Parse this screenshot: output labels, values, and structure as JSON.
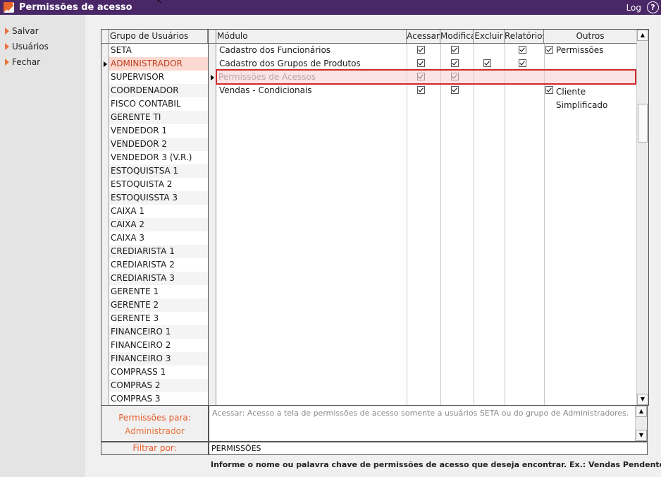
{
  "window": {
    "title": "Permissões de acesso",
    "log_label": "Log",
    "help_symbol": "?"
  },
  "sidebar": {
    "items": [
      {
        "label": "Salvar"
      },
      {
        "label": "Usuários"
      },
      {
        "label": "Fechar"
      }
    ]
  },
  "groups": {
    "header": "Grupo de Usuários",
    "selected_index": 1,
    "items": [
      "SETA",
      "ADMINISTRADOR",
      "SUPERVISOR",
      "COORDENADOR",
      "FISCO CONTABIL",
      "GERENTE TI",
      "VENDEDOR 1",
      "VENDEDOR 2",
      "VENDEDOR 3 (V.R.)",
      "ESTOQUISTSA 1",
      "ESTOQUISTA 2",
      "ESTOQUISSTA 3",
      "CAIXA 1",
      "CAIXA 2",
      "CAIXA 3",
      "CREDIARISTA 1",
      "CREDIARISTA 2",
      "CREDIARISTA 3",
      "GERENTE 1",
      "GERENTE 2",
      "GERENTE 3",
      "FINANCEIRO 1",
      "FINANCEIRO 2",
      "FINANCEIRO 3",
      "COMPRASS 1",
      "COMPRAS 2",
      "COMPRAS 3"
    ]
  },
  "modules": {
    "headers": {
      "module": "Módulo",
      "acessar": "Acessar",
      "modifica": "Modifica",
      "excluir": "Excluir",
      "relatorios": "Relatórios",
      "outros": "Outros"
    },
    "selected_index": 2,
    "rows": [
      {
        "name": "Cadastro dos Funcionários",
        "acessar": true,
        "modifica": true,
        "excluir": false,
        "relatorios": true,
        "outros_checked": true,
        "outros": "Permissões"
      },
      {
        "name": "Cadastro dos Grupos de Produtos",
        "acessar": true,
        "modifica": true,
        "excluir": true,
        "relatorios": true,
        "outros_checked": false,
        "outros": ""
      },
      {
        "name": "Permissões de Acessos",
        "acessar": true,
        "modifica": true,
        "excluir": false,
        "relatorios": false,
        "outros_checked": false,
        "outros": ""
      },
      {
        "name": "Vendas - Condicionais",
        "acessar": true,
        "modifica": true,
        "excluir": false,
        "relatorios": false,
        "outros_checked": true,
        "outros": "Cliente Simplificado"
      }
    ]
  },
  "description": {
    "label_title": "Permissões para:",
    "label_group": "Administrador",
    "text": "Acessar: Acesso a tela de permissões de acesso somente a usuários SETA ou do grupo de Administradores."
  },
  "filter": {
    "label": "Filtrar por:",
    "value": "PERMISSÕES"
  },
  "hint": "Informe o nome ou palavra chave de permissões de acesso que deseja encontrar. Ex.: Vendas Pendentes",
  "colors": {
    "titlebar": "#4a2868",
    "accent_orange": "#e8733a",
    "selection_red": "#d02a2a",
    "selected_row_bg": "#fbd9d1"
  }
}
